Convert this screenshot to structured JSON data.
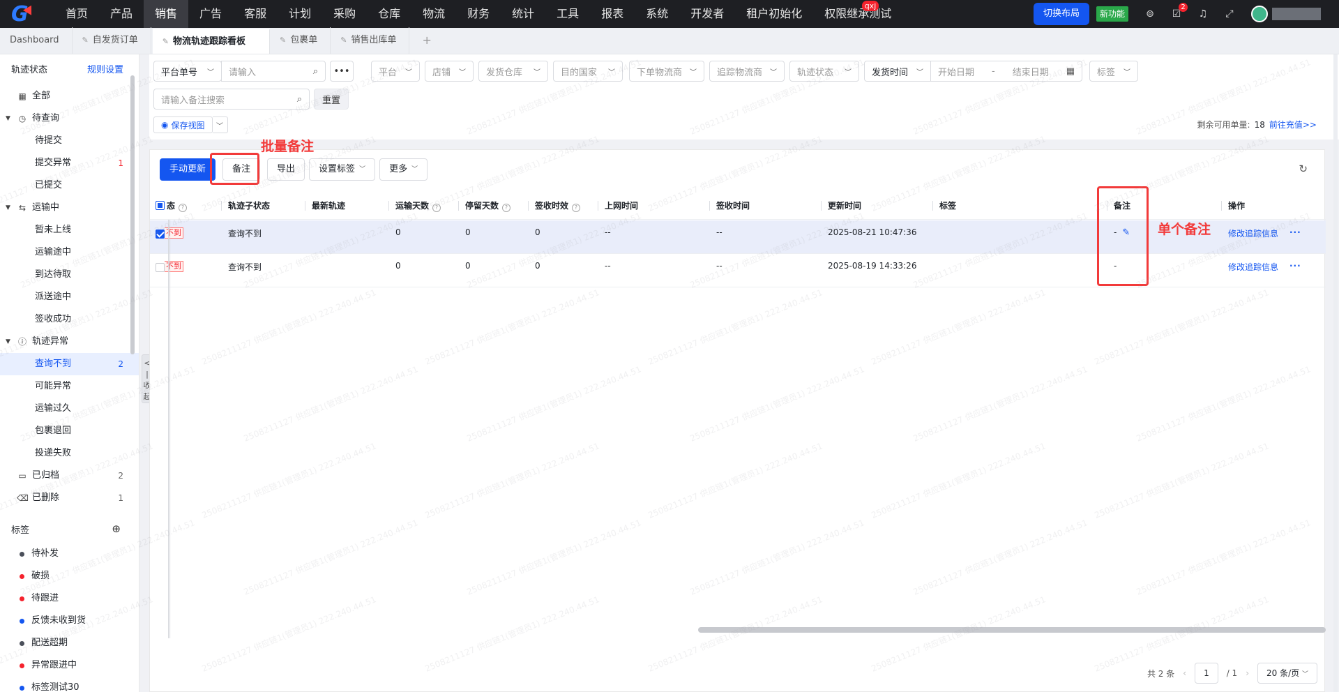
{
  "nav": {
    "items": [
      "首页",
      "产品",
      "销售",
      "广告",
      "客服",
      "计划",
      "采购",
      "仓库",
      "物流",
      "财务",
      "统计",
      "工具",
      "报表",
      "系统",
      "开发者",
      "租户初始化",
      "权限继承测试"
    ],
    "active_index": 2,
    "badge_text": "qxj",
    "switch_layout": "切换布局",
    "new_feature": "新功能",
    "task_badge": "2"
  },
  "tabs": [
    {
      "label": "Dashboard"
    },
    {
      "label": "自发货订单"
    },
    {
      "label": "物流轨迹跟踪看板"
    },
    {
      "label": "包裹单"
    },
    {
      "label": "销售出库单"
    }
  ],
  "tab_plus": "+",
  "sidebar": {
    "title": "轨迹状态",
    "rules_link": "规则设置",
    "items": [
      {
        "label": "全部",
        "count": "",
        "level": 0
      },
      {
        "label": "待查询",
        "count": "",
        "level": 0
      },
      {
        "label": "待提交",
        "count": "",
        "level": 1
      },
      {
        "label": "提交异常",
        "count": "1",
        "level": 1
      },
      {
        "label": "已提交",
        "count": "",
        "level": 1
      },
      {
        "label": "运输中",
        "count": "",
        "level": 0
      },
      {
        "label": "暂未上线",
        "count": "",
        "level": 1
      },
      {
        "label": "运输途中",
        "count": "",
        "level": 1
      },
      {
        "label": "到达待取",
        "count": "",
        "level": 1
      },
      {
        "label": "派送途中",
        "count": "",
        "level": 1
      },
      {
        "label": "签收成功",
        "count": "",
        "level": 1
      },
      {
        "label": "轨迹异常",
        "count": "",
        "level": 0
      },
      {
        "label": "查询不到",
        "count": "2",
        "level": 1
      },
      {
        "label": "可能异常",
        "count": "",
        "level": 1
      },
      {
        "label": "运输过久",
        "count": "",
        "level": 1
      },
      {
        "label": "包裹退回",
        "count": "",
        "level": 1
      },
      {
        "label": "投递失败",
        "count": "",
        "level": 1
      },
      {
        "label": "已归档",
        "count": "2",
        "level": 0
      },
      {
        "label": "已删除",
        "count": "1",
        "level": 0
      }
    ],
    "tags_title": "标签",
    "tags": [
      {
        "label": "待补发",
        "color": "#4a4f5a"
      },
      {
        "label": "破损",
        "color": "#f5222d"
      },
      {
        "label": "待跟进",
        "color": "#f5222d"
      },
      {
        "label": "反馈未收到货",
        "color": "#1456f0"
      },
      {
        "label": "配送超期",
        "color": "#4a4f5a"
      },
      {
        "label": "异常跟进中",
        "color": "#f5222d"
      },
      {
        "label": "标签测试30",
        "color": "#1456f0"
      }
    ],
    "collapse_label": "<|收起"
  },
  "filters": {
    "platform_no": "平台单号",
    "input_placeholder": "请输入",
    "platform": "平台",
    "shop": "店铺",
    "warehouse": "发货仓库",
    "country": "目的国家",
    "carrier": "下单物流商",
    "track_carrier": "追踪物流商",
    "track_status": "轨迹状态",
    "ship_time": "发货时间",
    "start_date": "开始日期",
    "date_sep": "-",
    "end_date": "结束日期",
    "tag": "标签",
    "remark_placeholder": "请输入备注搜索",
    "reset": "重置",
    "save_view": "保存视图",
    "quota_label": "剩余可用单量:",
    "quota_value": "18",
    "recharge": "前往充值>>"
  },
  "toolbar": {
    "manual_update": "手动更新",
    "remark": "备注",
    "export": "导出",
    "set_tag": "设置标签",
    "more": "更多"
  },
  "table": {
    "headers": [
      "态",
      "轨迹子状态",
      "最新轨迹",
      "运输天数",
      "停留天数",
      "签收时效",
      "上网时间",
      "签收时间",
      "更新时间",
      "标签",
      "备注",
      "操作"
    ],
    "rows": [
      {
        "status": "不到",
        "sub_status": "查询不到",
        "latest": "",
        "transit_days": "0",
        "stay_days": "0",
        "sign_eff": "0",
        "online_time": "--",
        "sign_time": "--",
        "update_time": "2025-08-21 10:47:36",
        "tag": "",
        "remark": "-",
        "action": "修改追踪信息",
        "selected": true
      },
      {
        "status": "不到",
        "sub_status": "查询不到",
        "latest": "",
        "transit_days": "0",
        "stay_days": "0",
        "sign_eff": "0",
        "online_time": "--",
        "sign_time": "--",
        "update_time": "2025-08-19 14:33:26",
        "tag": "",
        "remark": "-",
        "action": "修改追踪信息",
        "selected": false
      }
    ]
  },
  "pager": {
    "total": "共 2 条",
    "page": "1",
    "of": "/ 1",
    "size": "20 条/页"
  },
  "annotations": {
    "batch_remark": "批量备注",
    "single_remark": "单个备注"
  },
  "watermark": "2508211127 供应链1(管理员1) 222.240.44.51",
  "colors": {
    "accent": "#1456f0",
    "annotation": "#f23a3a",
    "nav_bg": "#1e1f23"
  }
}
